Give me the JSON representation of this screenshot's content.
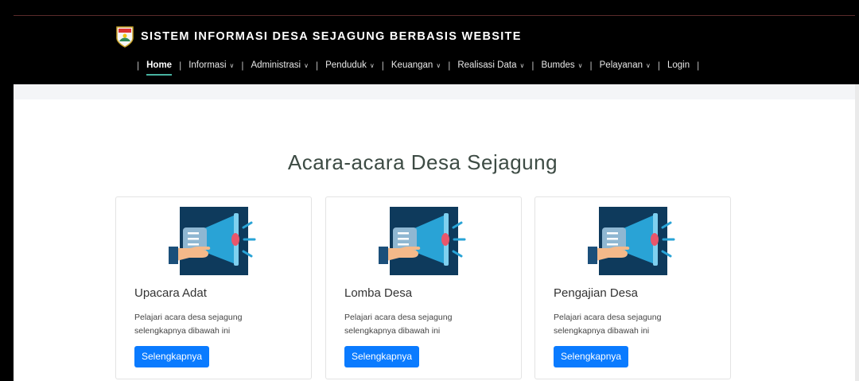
{
  "header": {
    "title": "SISTEM INFORMASI DESA SEJAGUNG BERBASIS WEBSITE",
    "logo_icon": "village-emblem-icon"
  },
  "nav": {
    "items": [
      {
        "label": "Home",
        "dropdown": false,
        "active": true
      },
      {
        "label": "Informasi",
        "dropdown": true
      },
      {
        "label": "Administrasi",
        "dropdown": true
      },
      {
        "label": "Penduduk",
        "dropdown": true
      },
      {
        "label": "Keuangan",
        "dropdown": true
      },
      {
        "label": "Realisasi Data",
        "dropdown": true
      },
      {
        "label": "Bumdes",
        "dropdown": true
      },
      {
        "label": "Pelayanan",
        "dropdown": true
      },
      {
        "label": "Login",
        "dropdown": false
      }
    ],
    "separator": "|",
    "caret": "∨"
  },
  "main": {
    "section_title": "Acara-acara Desa Sejagung",
    "cards": [
      {
        "title": "Upacara Adat",
        "line1": "Pelajari acara desa sejagung",
        "line2": "selengkapnya dibawah ini",
        "button": "Selengkapnya",
        "icon": "megaphone-icon"
      },
      {
        "title": "Lomba Desa",
        "line1": "Pelajari acara desa sejagung",
        "line2": "selengkapnya dibawah ini",
        "button": "Selengkapnya",
        "icon": "megaphone-icon"
      },
      {
        "title": "Pengajian Desa",
        "line1": "Pelajari acara desa sejagung",
        "line2": "selengkapnya dibawah ini",
        "button": "Selengkapnya",
        "icon": "megaphone-icon"
      }
    ]
  },
  "colors": {
    "header_bg": "#000000",
    "active_underline": "#47b2a0",
    "button_bg": "#0a7bff",
    "illustration_bg": "#0e3a5c"
  }
}
